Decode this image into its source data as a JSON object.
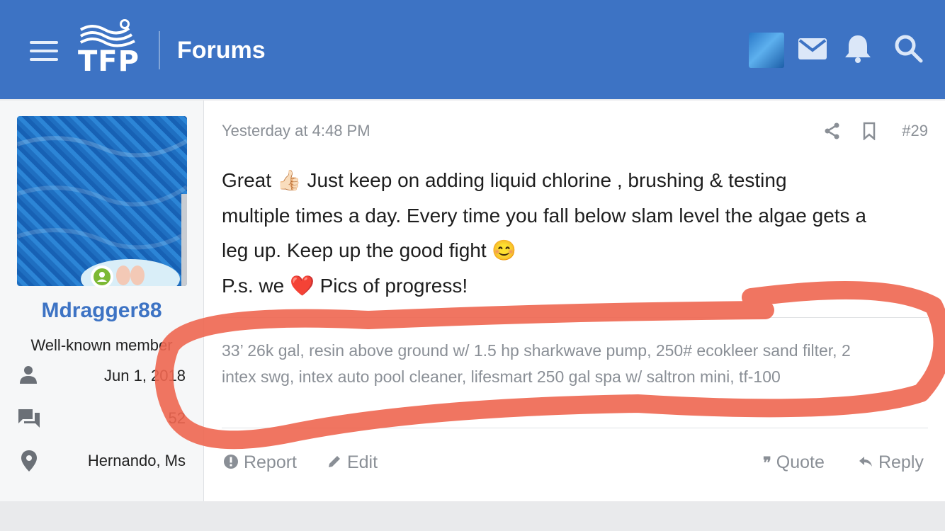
{
  "header": {
    "logo_text": "TFP",
    "section_title": "Forums"
  },
  "user": {
    "name": "Mdragger88",
    "title": "Well-known member",
    "joined": "Jun 1, 2018",
    "messages": "52",
    "location": "Hernando, Ms"
  },
  "post": {
    "date": "Yesterday at 4:48 PM",
    "number": "#29",
    "lines": [
      "Great 👍🏻 Just keep on adding liquid chlorine , brushing & testing",
      "multiple times a day. Every time you fall below slam level the algae gets a",
      "leg up. Keep up the good fight 😊",
      "P.s. we ❤️ Pics of progress!"
    ],
    "signature_lines": [
      "33’ 26k gal, resin above ground w/ 1.5 hp sharkwave pump, 250# ecokleer sand filter, 2",
      "intex swg, intex auto pool cleaner, lifesmart 250 gal spa w/ saltron mini, tf-100"
    ]
  },
  "actions": {
    "report": "Report",
    "edit": "Edit",
    "quote": "Quote",
    "reply": "Reply"
  },
  "colors": {
    "header_bg": "#3d73c4",
    "link": "#3d73c4",
    "muted": "#8a8f96",
    "online": "#7cb935",
    "annotation": "#ee6650"
  }
}
